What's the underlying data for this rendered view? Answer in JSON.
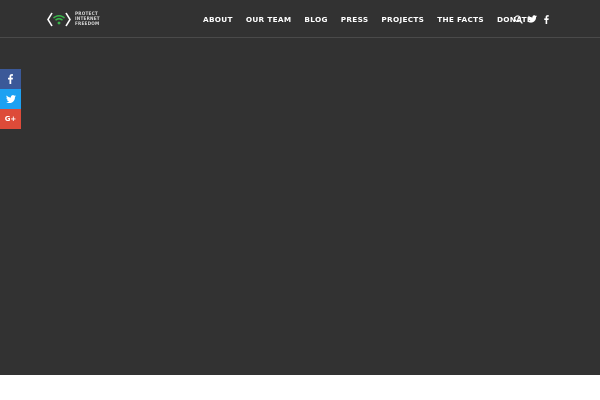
{
  "brand": {
    "logo_lines": [
      "PROTECT",
      "INTERNET",
      "FREEDOM"
    ],
    "colors": {
      "accent_green": "#39b54a",
      "hero_background": "#323232",
      "page_background": "#ffffff"
    }
  },
  "header": {
    "nav": [
      {
        "label": "ABOUT"
      },
      {
        "label": "OUR TEAM"
      },
      {
        "label": "BLOG"
      },
      {
        "label": "PRESS"
      },
      {
        "label": "PROJECTS"
      },
      {
        "label": "THE FACTS"
      },
      {
        "label": "DONATE"
      }
    ],
    "icons": [
      "search-icon",
      "twitter-icon",
      "facebook-icon"
    ]
  },
  "share_bar": {
    "buttons": [
      {
        "network": "facebook",
        "icon": "facebook-icon",
        "color": "#3b5998"
      },
      {
        "network": "twitter",
        "icon": "twitter-icon",
        "color": "#1da1f2"
      },
      {
        "network": "google-plus",
        "icon": "google-plus-icon",
        "label": "G+",
        "color": "#dd4b39"
      }
    ]
  }
}
